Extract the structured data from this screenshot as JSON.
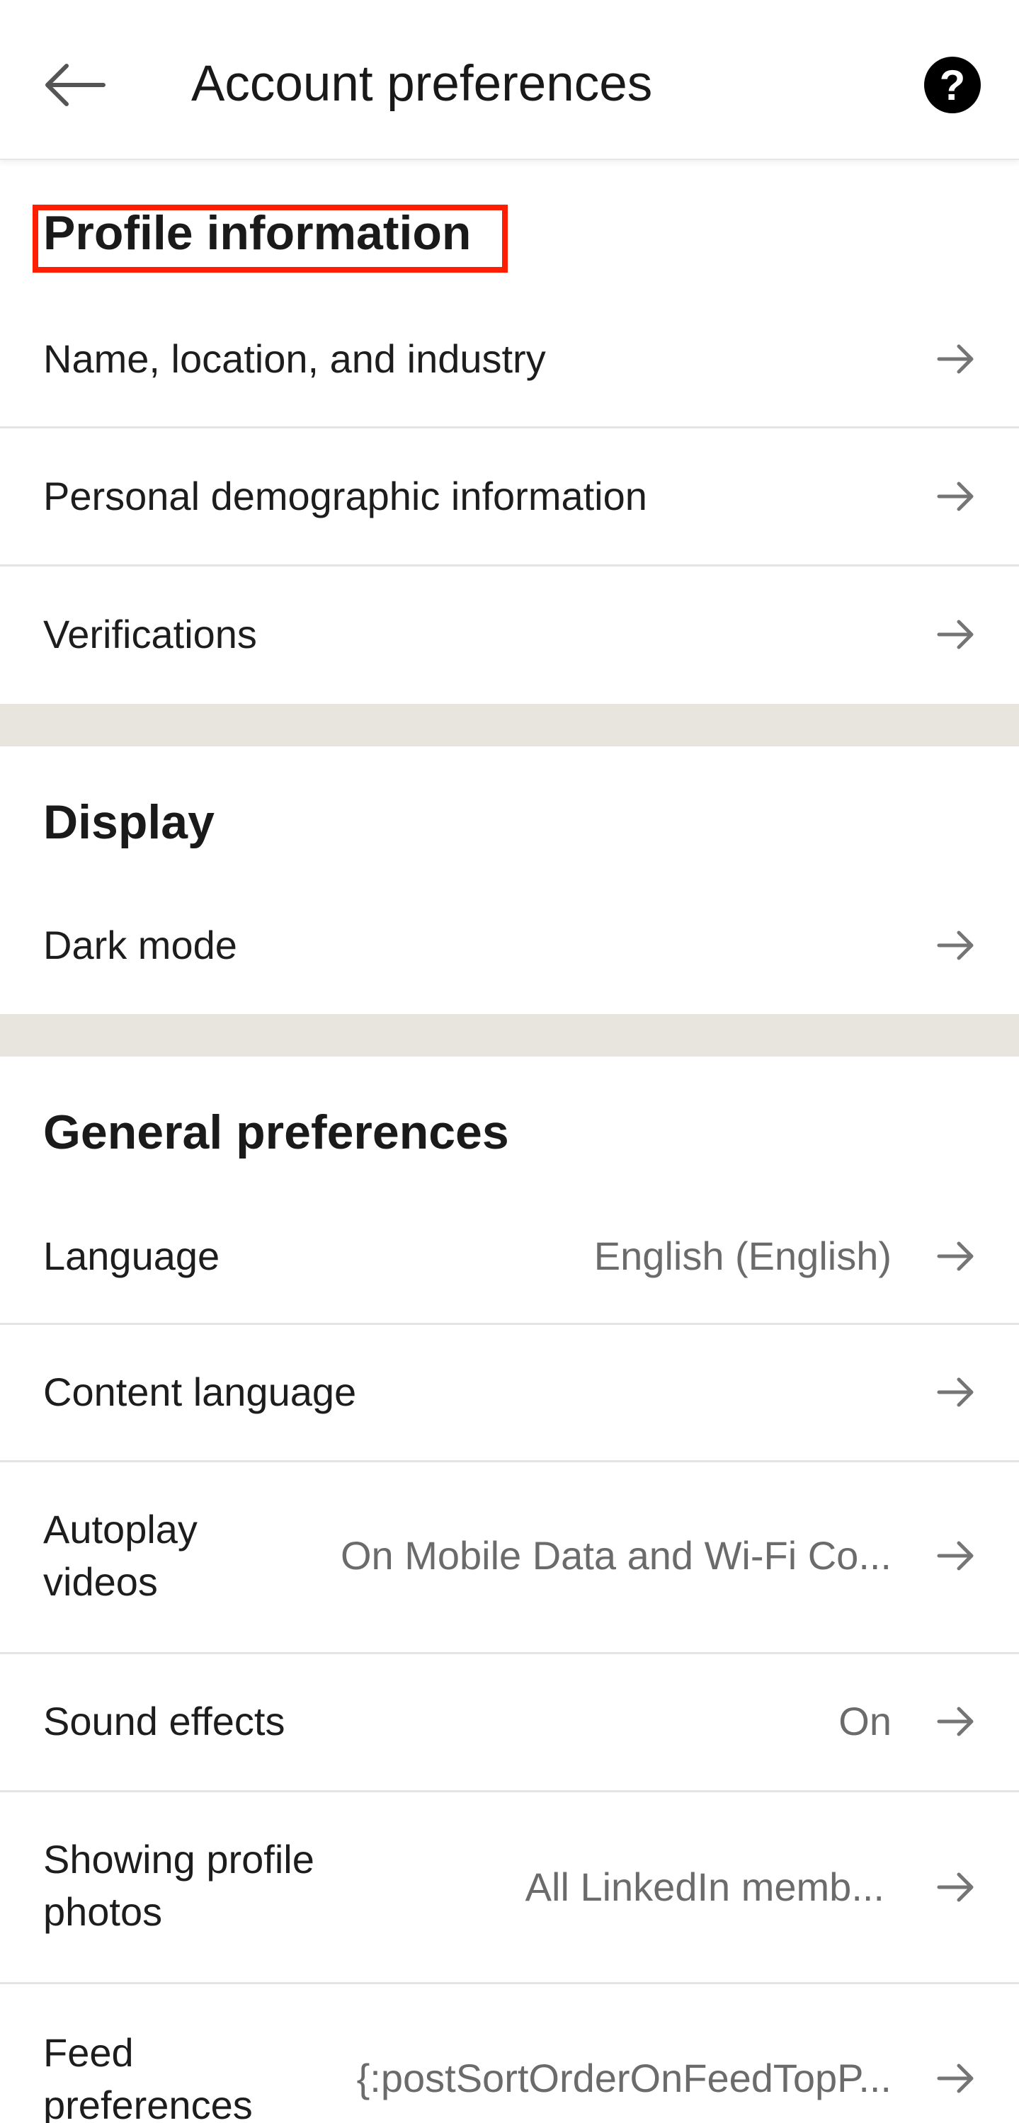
{
  "header": {
    "title": "Account preferences"
  },
  "sections": {
    "profile": {
      "title": "Profile information",
      "items": [
        {
          "label": "Name, location, and industry"
        },
        {
          "label": "Personal demographic information"
        },
        {
          "label": "Verifications"
        }
      ]
    },
    "display": {
      "title": "Display",
      "items": [
        {
          "label": "Dark mode"
        }
      ]
    },
    "general": {
      "title": "General preferences",
      "items": [
        {
          "label": "Language",
          "value": "English (English)"
        },
        {
          "label": "Content language",
          "value": ""
        },
        {
          "label": "Autoplay\nvideos",
          "value": "On Mobile Data and Wi-Fi Co..."
        },
        {
          "label": "Sound effects",
          "value": "On"
        },
        {
          "label": "Showing profile\nphotos",
          "value": "All LinkedIn memb..."
        },
        {
          "label": "Feed\npreferences",
          "value": "{:postSortOrderOnFeedTopP..."
        }
      ]
    }
  },
  "colors": {
    "highlight": "#ff1e00",
    "section_band": "#e8e5df",
    "arrow": "#757575"
  }
}
